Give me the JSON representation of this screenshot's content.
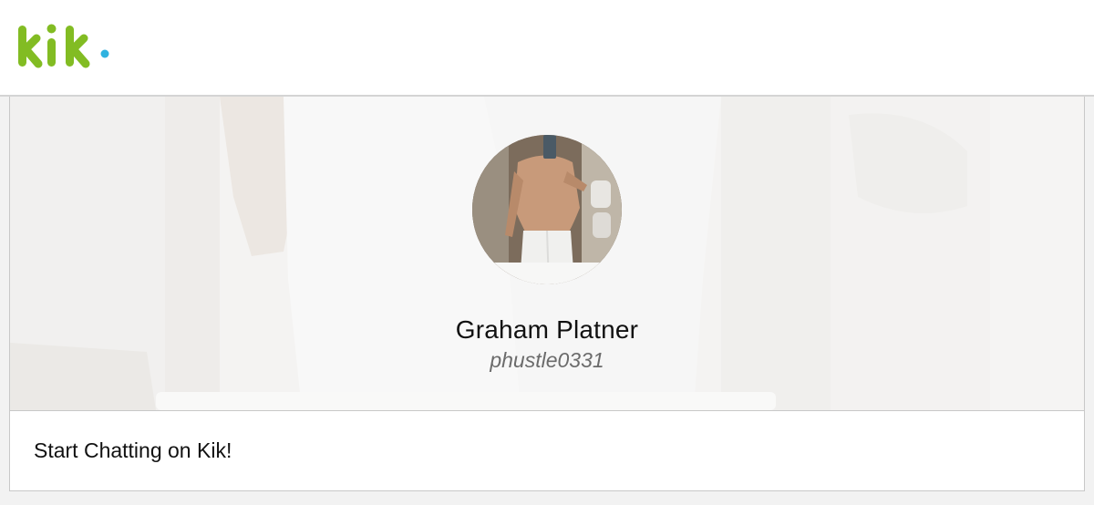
{
  "header": {
    "logo_icon": "kik-logo",
    "logo_color": "#82bc23",
    "logo_dot_color": "#2fb3e0"
  },
  "profile": {
    "display_name": "Graham Platner",
    "username": "phustle0331",
    "avatar_icon": "profile-photo",
    "banner_icon": "profile-banner-photo"
  },
  "cta": {
    "label": "Start Chatting on Kik!"
  }
}
